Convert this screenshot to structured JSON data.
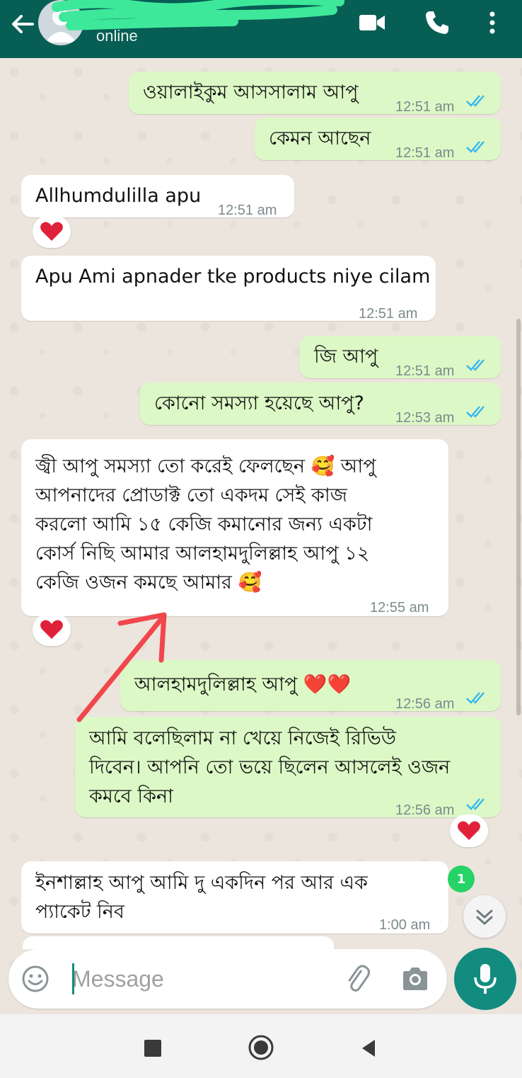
{
  "header": {
    "status": "online",
    "colors": {
      "bar": "#075e54",
      "accent": "#25d366"
    }
  },
  "messages": [
    {
      "dir": "out",
      "text": "ওয়ালাইকুম আসসালাম আপু",
      "time": "12:51 am",
      "read": true
    },
    {
      "dir": "out",
      "text": "কেমন আছেন",
      "time": "12:51 am",
      "read": true
    },
    {
      "dir": "in",
      "text": "Allhumdulilla apu",
      "time": "12:51 am",
      "reaction": "red-heart"
    },
    {
      "dir": "in",
      "text": "Apu Ami apnader tke products niye cilam",
      "time": "12:51 am"
    },
    {
      "dir": "out",
      "text": "জি আপু",
      "time": "12:51 am",
      "read": true
    },
    {
      "dir": "out",
      "text": "কোনো সমস্যা হয়েছে আপু?",
      "time": "12:53 am",
      "read": true
    },
    {
      "dir": "in",
      "text": "জ্বী আপু সমস্যা তো করেই ফেলছেন 🥰 আপু\nআপনাদের প্রোডাক্ট তো একদম সেই কাজ\nকরলো আমি ১৫ কেজি কমানোর জন্য একটা\nকোর্স নিছি আমার আলহামদুলিল্লাহ আপু ১২\nকেজি ওজন কমছে আমার 🥰",
      "time": "12:55 am",
      "reaction": "red-heart"
    },
    {
      "dir": "out",
      "text": "আলহামদুলিল্লাহ আপু ❤️❤️",
      "time": "12:56 am",
      "read": true
    },
    {
      "dir": "out",
      "text": "আমি বলেছিলাম না খেয়ে নিজেই রিভিউ\nদিবেন। আপনি তো ভয়ে ছিলেন আসলেই ওজন\nকমবে কিনা",
      "time": "12:56 am",
      "read": true,
      "reaction": "red-heart"
    },
    {
      "dir": "in",
      "text": "ইনশাল্লাহ আপু আমি দু একদিন পর আর এক\nপ্যাকেট নিব",
      "time": "1:00 am"
    }
  ],
  "unread_count": "1",
  "input": {
    "placeholder": "Message"
  },
  "icons": {
    "back": "arrow-left-icon",
    "video": "video-call-icon",
    "call": "phone-icon",
    "menu": "more-vert-icon",
    "emoji": "emoji-icon",
    "attach": "paperclip-icon",
    "camera": "camera-icon",
    "mic": "mic-icon",
    "read": "double-check-icon",
    "reaction": "heart-icon",
    "scroll": "chevron-double-down-icon"
  }
}
